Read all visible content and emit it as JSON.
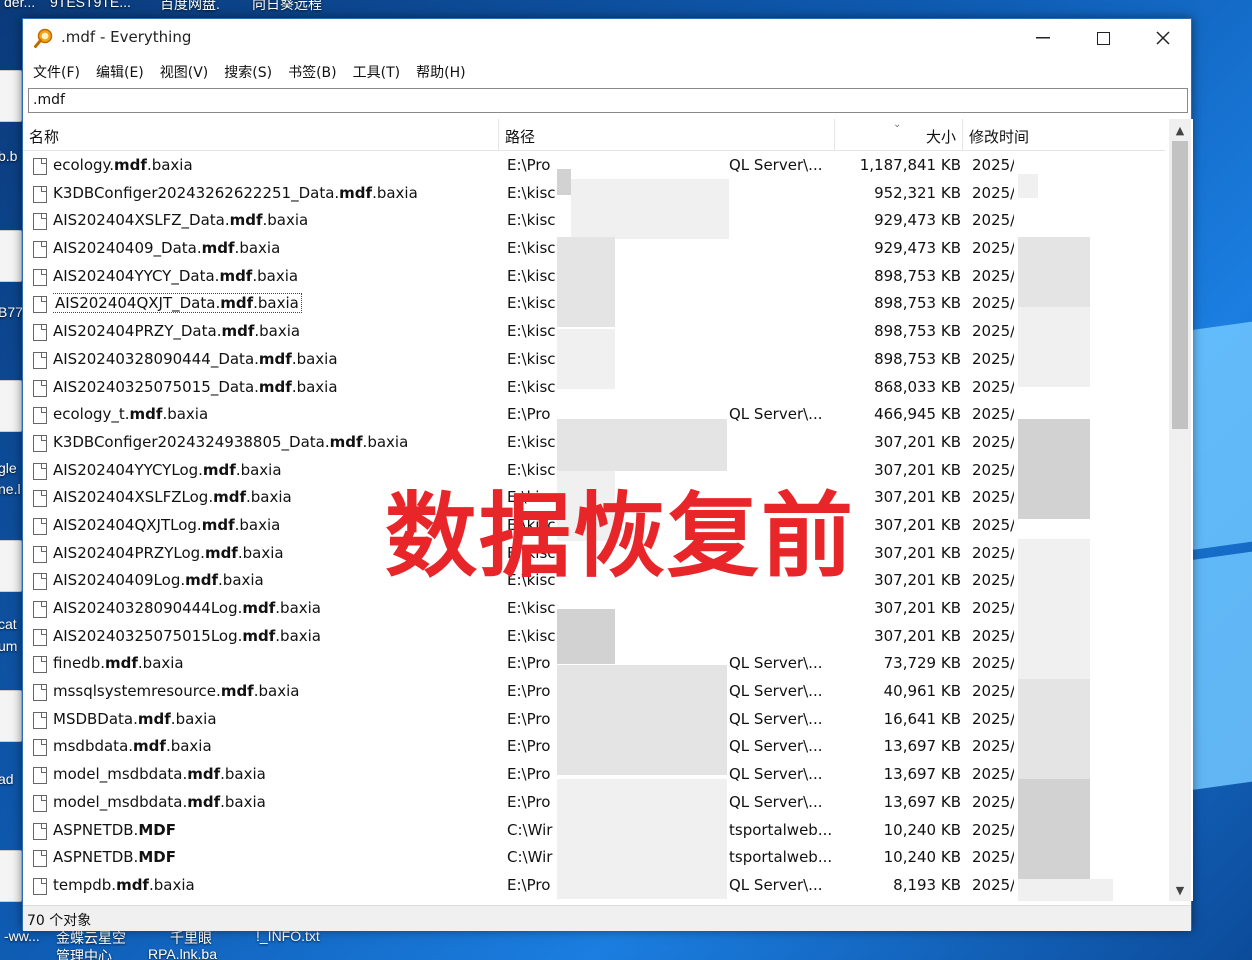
{
  "desktop": {
    "top_labels": [
      "der...",
      "9TEST9TE...",
      "百度网盘.",
      "向日葵远程"
    ],
    "bottom_labels": [
      "-ww...",
      "金蝶云星空",
      "千里眼",
      "!_INFO.txt"
    ],
    "bottom_labels2": [
      "管理中心",
      "RPA.lnk.ba"
    ],
    "left_fragments": [
      "b.b",
      "B77",
      "gle",
      "ne.l",
      "cat",
      "um",
      "ad"
    ]
  },
  "window": {
    "title": ".mdf - Everything",
    "menu": [
      "文件(F)",
      "编辑(E)",
      "视图(V)",
      "搜索(S)",
      "书签(B)",
      "工具(T)",
      "帮助(H)"
    ],
    "search_value": ".mdf",
    "columns": {
      "name": "名称",
      "path": "路径",
      "size": "大小",
      "modified": "修改时间"
    },
    "status": "70 个对象",
    "overlay_text": "数据恢复前"
  },
  "rows": [
    {
      "pre": "ecology.",
      "bold": "mdf",
      "post": ".baxia",
      "path": "E:\\Pro",
      "path2": "QL Server\\...",
      "size": "1,187,841 KB",
      "date": "2025/"
    },
    {
      "pre": "K3DBConfiger20243262622251_Data.",
      "bold": "mdf",
      "post": ".baxia",
      "path": "E:\\kisc",
      "path2": "",
      "size": "952,321 KB",
      "date": "2025/"
    },
    {
      "pre": "AIS202404XSLFZ_Data.",
      "bold": "mdf",
      "post": ".baxia",
      "path": "E:\\kisc",
      "path2": "",
      "size": "929,473 KB",
      "date": "2025/"
    },
    {
      "pre": "AIS20240409_Data.",
      "bold": "mdf",
      "post": ".baxia",
      "path": "E:\\kisc",
      "path2": "",
      "size": "929,473 KB",
      "date": "2025/"
    },
    {
      "pre": "AIS202404YYCY_Data.",
      "bold": "mdf",
      "post": ".baxia",
      "path": "E:\\kisc",
      "path2": "",
      "size": "898,753 KB",
      "date": "2025/"
    },
    {
      "pre": "AIS202404QXJT_Data.",
      "bold": "mdf",
      "post": ".baxia",
      "path": "E:\\kisc",
      "path2": "",
      "size": "898,753 KB",
      "date": "2025/"
    },
    {
      "pre": "AIS202404PRZY_Data.",
      "bold": "mdf",
      "post": ".baxia",
      "path": "E:\\kisc",
      "path2": "",
      "size": "898,753 KB",
      "date": "2025/"
    },
    {
      "pre": "AIS20240328090444_Data.",
      "bold": "mdf",
      "post": ".baxia",
      "path": "E:\\kisc",
      "path2": "",
      "size": "898,753 KB",
      "date": "2025/"
    },
    {
      "pre": "AIS20240325075015_Data.",
      "bold": "mdf",
      "post": ".baxia",
      "path": "E:\\kisc",
      "path2": "",
      "size": "868,033 KB",
      "date": "2025/"
    },
    {
      "pre": "ecology_t.",
      "bold": "mdf",
      "post": ".baxia",
      "path": "E:\\Pro",
      "path2": "QL Server\\...",
      "size": "466,945 KB",
      "date": "2025/"
    },
    {
      "pre": "K3DBConfiger2024324938805_Data.",
      "bold": "mdf",
      "post": ".baxia",
      "path": "E:\\kisc",
      "path2": "",
      "size": "307,201 KB",
      "date": "2025/"
    },
    {
      "pre": "AIS202404YYCYLog.",
      "bold": "mdf",
      "post": ".baxia",
      "path": "E:\\kisc",
      "path2": "",
      "size": "307,201 KB",
      "date": "2025/"
    },
    {
      "pre": "AIS202404XSLFZLog.",
      "bold": "mdf",
      "post": ".baxia",
      "path": "E:\\kisc",
      "path2": "",
      "size": "307,201 KB",
      "date": "2025/"
    },
    {
      "pre": "AIS202404QXJTLog.",
      "bold": "mdf",
      "post": ".baxia",
      "path": "E:\\kisc",
      "path2": "",
      "size": "307,201 KB",
      "date": "2025/"
    },
    {
      "pre": "AIS202404PRZYLog.",
      "bold": "mdf",
      "post": ".baxia",
      "path": "E:\\kisc",
      "path2": "",
      "size": "307,201 KB",
      "date": "2025/"
    },
    {
      "pre": "AIS20240409Log.",
      "bold": "mdf",
      "post": ".baxia",
      "path": "E:\\kisc",
      "path2": "",
      "size": "307,201 KB",
      "date": "2025/"
    },
    {
      "pre": "AIS20240328090444Log.",
      "bold": "mdf",
      "post": ".baxia",
      "path": "E:\\kisc",
      "path2": "",
      "size": "307,201 KB",
      "date": "2025/"
    },
    {
      "pre": "AIS20240325075015Log.",
      "bold": "mdf",
      "post": ".baxia",
      "path": "E:\\kisc",
      "path2": "",
      "size": "307,201 KB",
      "date": "2025/"
    },
    {
      "pre": "finedb.",
      "bold": "mdf",
      "post": ".baxia",
      "path": "E:\\Pro",
      "path2": "QL Server\\...",
      "size": "73,729 KB",
      "date": "2025/"
    },
    {
      "pre": "mssqlsystemresource.",
      "bold": "mdf",
      "post": ".baxia",
      "path": "E:\\Pro",
      "path2": "QL Server\\...",
      "size": "40,961 KB",
      "date": "2025/"
    },
    {
      "pre": "MSDBData.",
      "bold": "mdf",
      "post": ".baxia",
      "path": "E:\\Pro",
      "path2": "QL Server\\...",
      "size": "16,641 KB",
      "date": "2025/"
    },
    {
      "pre": "msdbdata.",
      "bold": "mdf",
      "post": ".baxia",
      "path": "E:\\Pro",
      "path2": "QL Server\\...",
      "size": "13,697 KB",
      "date": "2025/"
    },
    {
      "pre": "model_msdbdata.",
      "bold": "mdf",
      "post": ".baxia",
      "path": "E:\\Pro",
      "path2": "QL Server\\...",
      "size": "13,697 KB",
      "date": "2025/"
    },
    {
      "pre": "model_msdbdata.",
      "bold": "mdf",
      "post": ".baxia",
      "path": "E:\\Pro",
      "path2": "QL Server\\...",
      "size": "13,697 KB",
      "date": "2025/"
    },
    {
      "pre": "ASPNETDB.",
      "bold": "MDF",
      "post": "",
      "path": "C:\\Wir",
      "path2": "tsportalweb...",
      "size": "10,240 KB",
      "date": "2025/8"
    },
    {
      "pre": "ASPNETDB.",
      "bold": "MDF",
      "post": "",
      "path": "C:\\Wir",
      "path2": "tsportalweb...",
      "size": "10,240 KB",
      "date": "2025/8"
    },
    {
      "pre": "tempdb.",
      "bold": "mdf",
      "post": ".baxia",
      "path": "E:\\Pro",
      "path2": "QL Server\\...",
      "size": "8,193 KB",
      "date": "2025/"
    }
  ]
}
